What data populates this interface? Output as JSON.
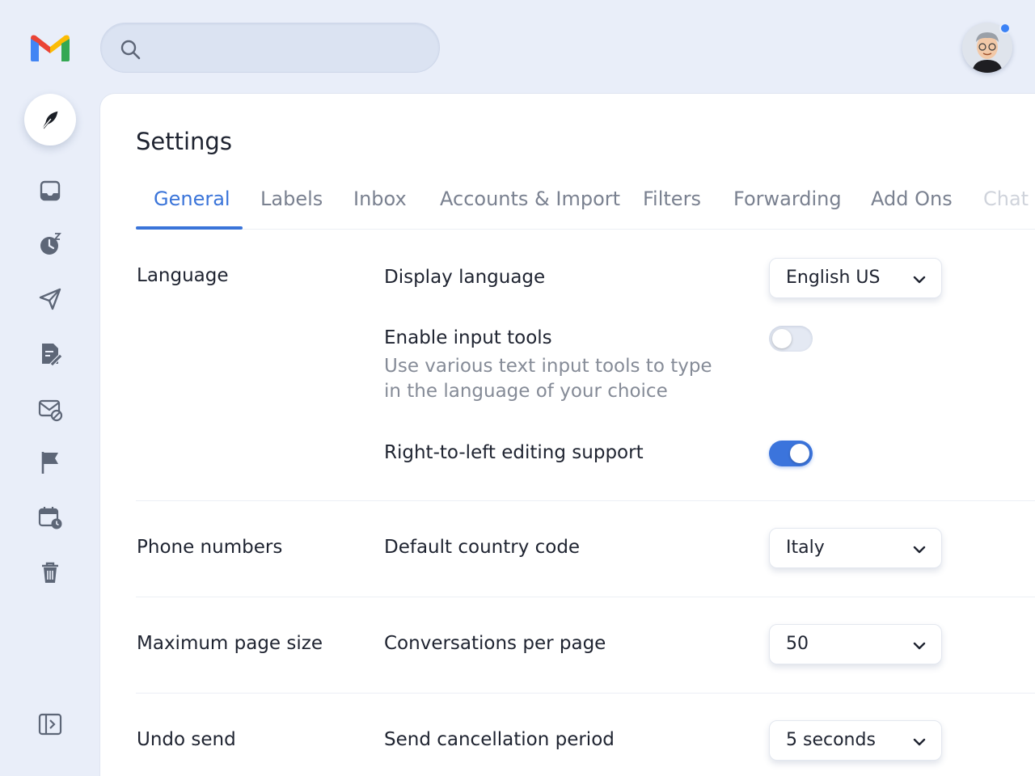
{
  "app": {
    "logo_text": "M",
    "search_placeholder": ""
  },
  "colors": {
    "accent": "#3a74d9",
    "background": "#e9eef9",
    "notification_dot": "#3b82f6"
  },
  "sidebar": {
    "items": [
      {
        "name": "compose",
        "icon": "feather-icon"
      },
      {
        "name": "inbox",
        "icon": "inbox-icon"
      },
      {
        "name": "snoozed",
        "icon": "snooze-clock-icon"
      },
      {
        "name": "sent",
        "icon": "send-icon"
      },
      {
        "name": "drafts",
        "icon": "draft-edit-icon"
      },
      {
        "name": "spam",
        "icon": "mail-blocked-icon"
      },
      {
        "name": "flagged",
        "icon": "flag-icon"
      },
      {
        "name": "scheduled",
        "icon": "calendar-clock-icon"
      },
      {
        "name": "trash",
        "icon": "trash-icon"
      },
      {
        "name": "expand",
        "icon": "collapse-panel-icon"
      }
    ]
  },
  "page": {
    "title": "Settings",
    "tabs": [
      {
        "label": "General",
        "active": true
      },
      {
        "label": "Labels"
      },
      {
        "label": "Inbox"
      },
      {
        "label": "Accounts & Import"
      },
      {
        "label": "Filters"
      },
      {
        "label": "Forwarding"
      },
      {
        "label": "Add Ons"
      },
      {
        "label": "Chat"
      }
    ]
  },
  "sections": {
    "language": {
      "label": "Language",
      "display_language": {
        "label": "Display language",
        "value": "English US"
      },
      "input_tools": {
        "label": "Enable input tools",
        "description": "Use various text input tools to type in the language of your choice",
        "enabled": false
      },
      "rtl": {
        "label": "Right-to-left editing support",
        "enabled": true
      }
    },
    "phone": {
      "label": "Phone numbers",
      "country_code": {
        "label": "Default country code",
        "value": "Italy"
      }
    },
    "page_size": {
      "label": "Maximum page size",
      "conversations": {
        "label": "Conversations per page",
        "value": "50"
      }
    },
    "undo_send": {
      "label": "Undo send",
      "period": {
        "label": "Send cancellation period",
        "value": "5 seconds"
      }
    }
  }
}
